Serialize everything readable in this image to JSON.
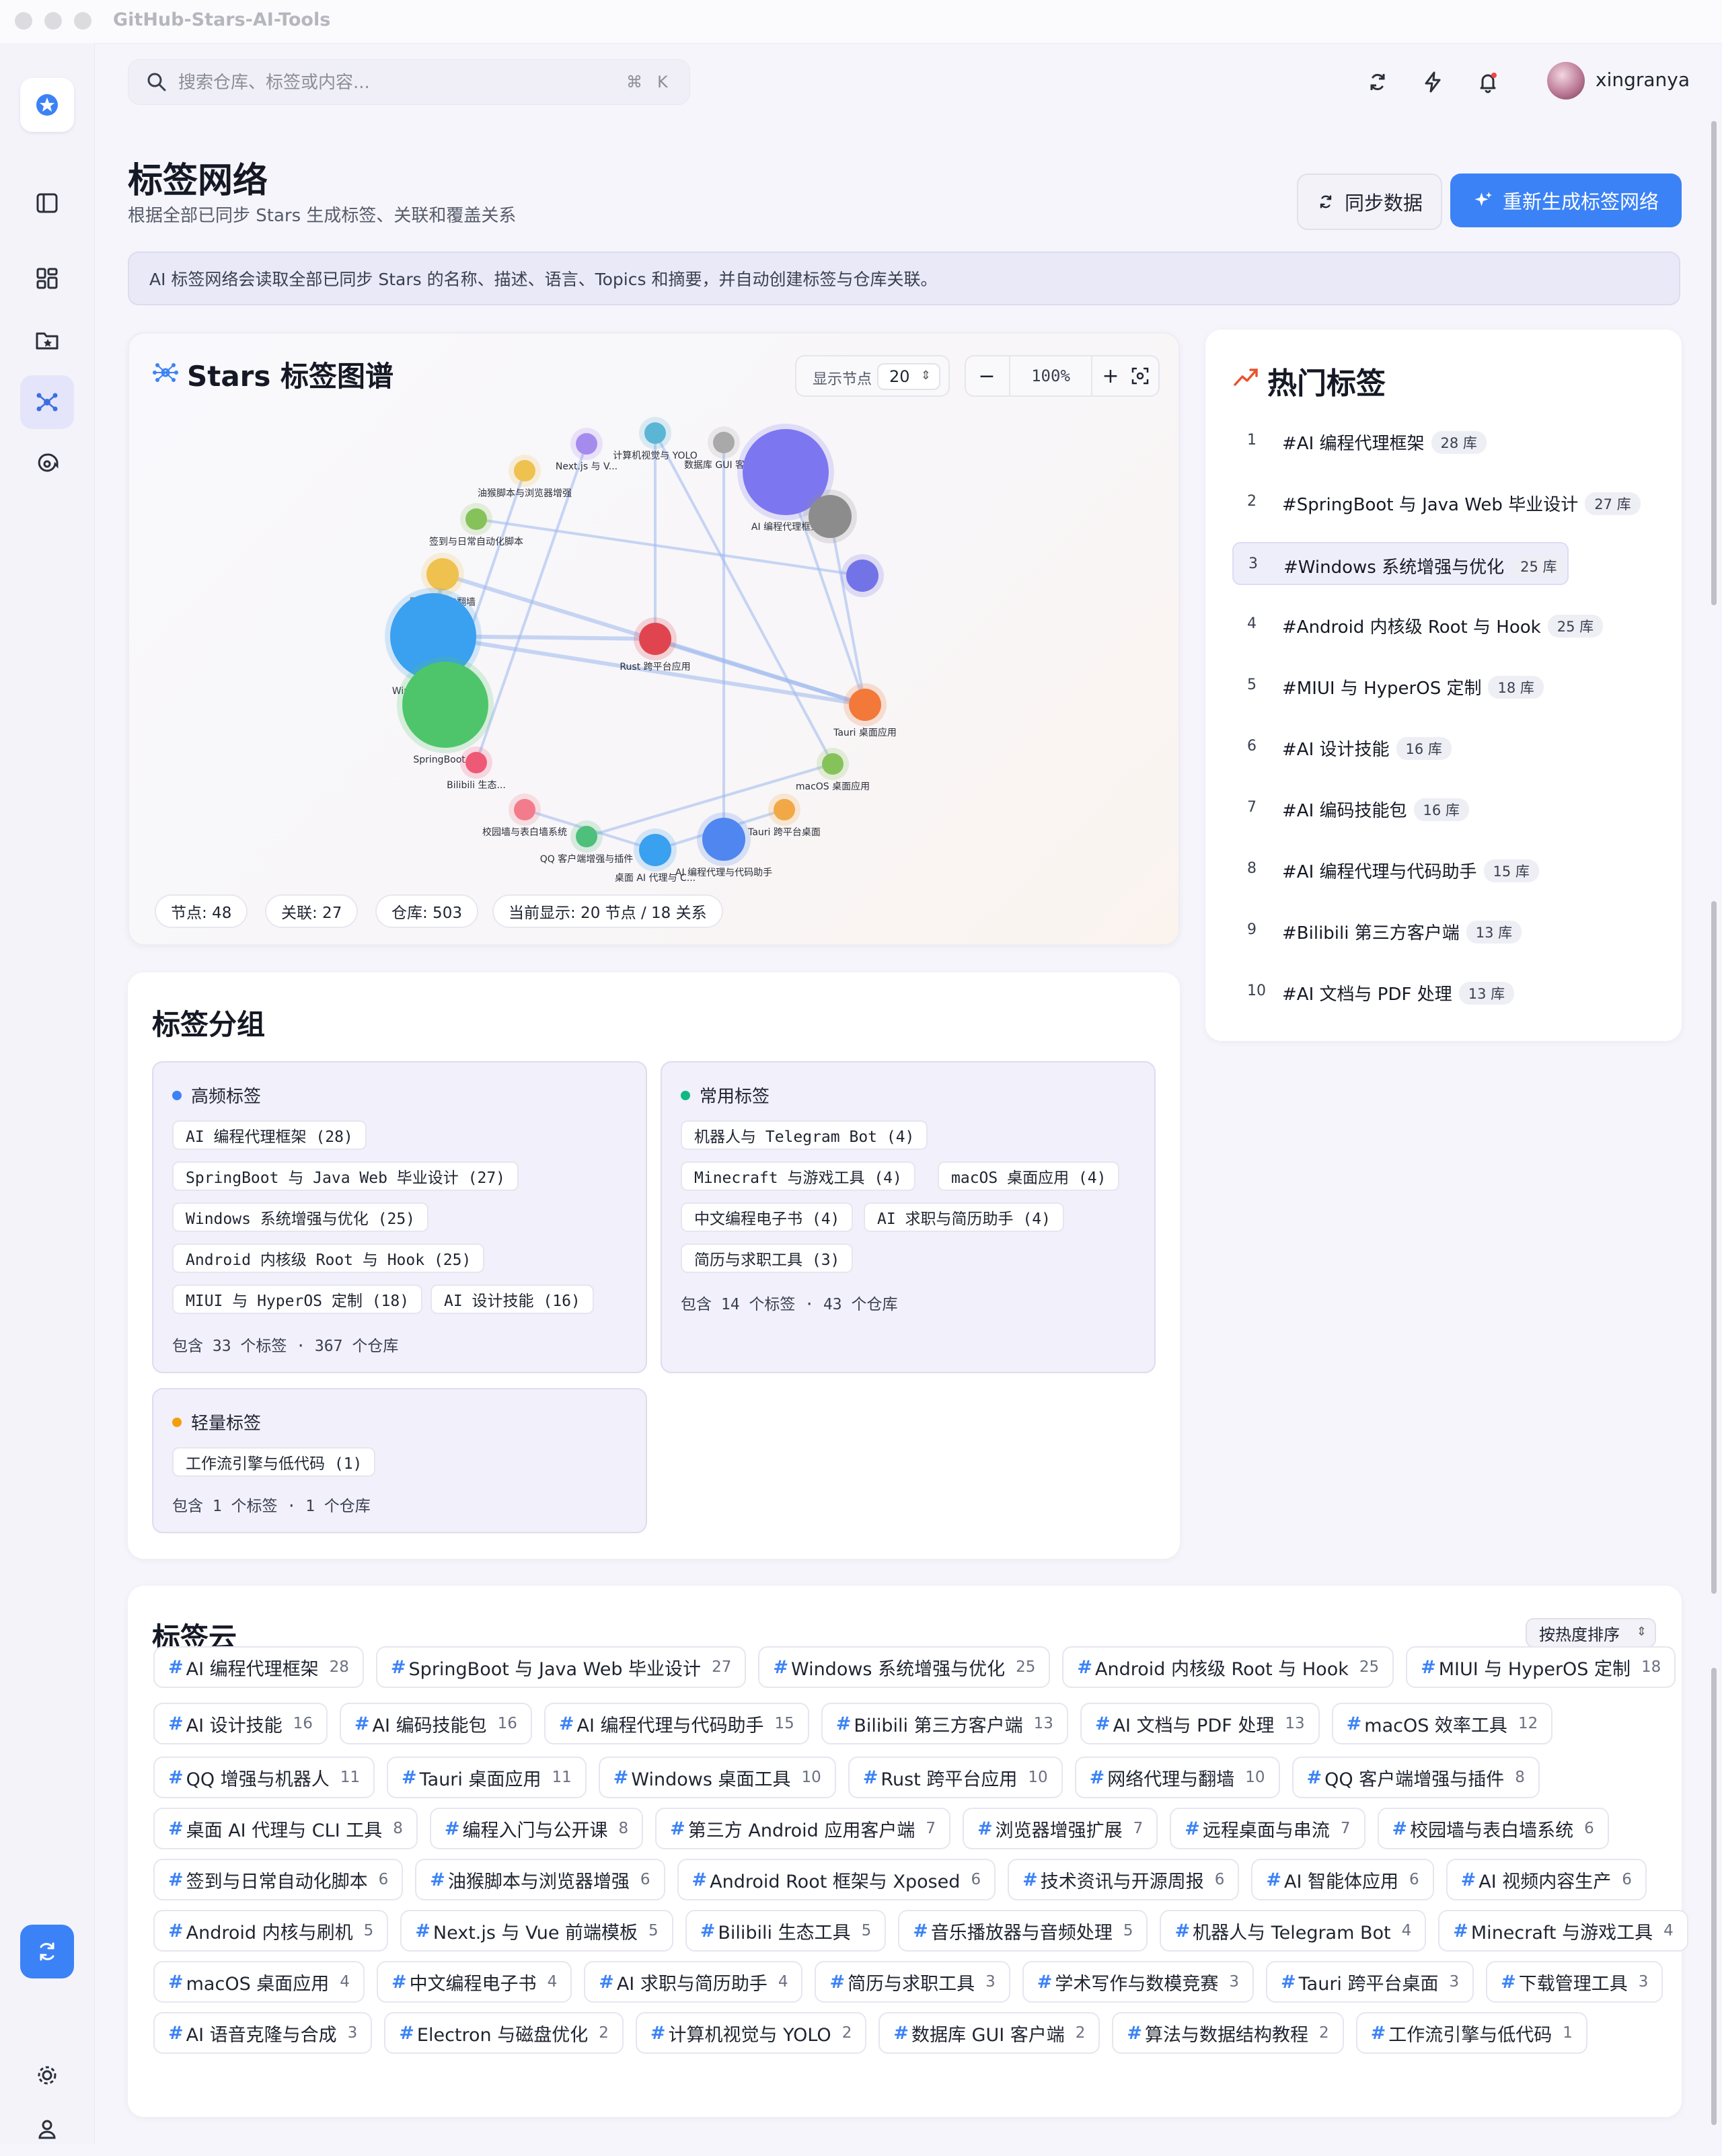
{
  "app": {
    "title": "GitHub-Stars-AI-Tools"
  },
  "topbar": {
    "search_placeholder": "搜索仓库、标签或内容...",
    "shortcut_cmd": "⌘",
    "shortcut_key": "K",
    "username": "xingranya"
  },
  "header": {
    "title": "标签网络",
    "subtitle": "根据全部已同步 Stars 生成标签、关联和覆盖关系",
    "sync_label": "同步数据",
    "regen_label": "重新生成标签网络"
  },
  "banner": {
    "text": "AI 标签网络会读取全部已同步 Stars 的名称、描述、语言、Topics 和摘要，并自动创建标签与仓库关联。"
  },
  "graph": {
    "title": "Stars 标签图谱",
    "nodes_label": "显示节点",
    "nodes_value": "20",
    "zoom": "100%",
    "nodes": [
      {
        "label": "计算机视觉与 YOLO",
        "color": "#5bb5d5",
        "size": 1
      },
      {
        "label": "数据库 GUI 客户端",
        "color": "#a9a9a9",
        "size": 1
      },
      {
        "label": "Next.js 与 V...",
        "color": "#a68bef",
        "size": 1
      },
      {
        "label": "AI 编程代理框架",
        "color": "#7c76f0",
        "size": 4
      },
      {
        "label": "油猴脚本与浏览器增强",
        "color": "#efc14f",
        "size": 1
      },
      {
        "label": "",
        "color": "#8c8c8c",
        "size": 2
      },
      {
        "label": "签到与日常自动化脚本",
        "color": "#86c25a",
        "size": 1
      },
      {
        "label": "",
        "color": "#7373e8",
        "size": 1.5
      },
      {
        "label": "网络代理与翻墙",
        "color": "#efc14f",
        "size": 1.5
      },
      {
        "label": "Windows 系统增...",
        "color": "#3aa0f0",
        "size": 4
      },
      {
        "label": "Rust 跨平台应用",
        "color": "#e0454f",
        "size": 1.5
      },
      {
        "label": "Tauri 桌面应用",
        "color": "#f2793a",
        "size": 1.5
      },
      {
        "label": "SpringBoot ...",
        "color": "#4ec56a",
        "size": 4
      },
      {
        "label": "Bilibili 生态...",
        "color": "#ee5a76",
        "size": 1
      },
      {
        "label": "macOS 桌面应用",
        "color": "#86c25a",
        "size": 1
      },
      {
        "label": "校园墙与表白墙系统",
        "color": "#f27c8c",
        "size": 1
      },
      {
        "label": "Tauri 跨平台桌面",
        "color": "#f2a846",
        "size": 1
      },
      {
        "label": "QQ 客户端增强与插件",
        "color": "#4fbf7c",
        "size": 1
      },
      {
        "label": "桌面 AI 代理与 C...",
        "color": "#3aa0f0",
        "size": 1.5
      },
      {
        "label": "AI 编程代理与代码助手",
        "color": "#4f86f0",
        "size": 2
      }
    ],
    "stats": [
      "节点: 48",
      "关联: 27",
      "仓库: 503",
      "当前显示: 20 节点 / 18 关系"
    ]
  },
  "hot_tags": {
    "title": "热门标签",
    "items": [
      {
        "rank": "1",
        "name": "#AI 编程代理框架",
        "count": "28 库"
      },
      {
        "rank": "2",
        "name": "#SpringBoot 与 Java Web 毕业设计",
        "count": "27 库"
      },
      {
        "rank": "3",
        "name": "#Windows 系统增强与优化",
        "count": "25 库"
      },
      {
        "rank": "4",
        "name": "#Android 内核级 Root 与 Hook",
        "count": "25 库"
      },
      {
        "rank": "5",
        "name": "#MIUI 与 HyperOS 定制",
        "count": "18 库"
      },
      {
        "rank": "6",
        "name": "#AI 设计技能",
        "count": "16 库"
      },
      {
        "rank": "7",
        "name": "#AI 编码技能包",
        "count": "16 库"
      },
      {
        "rank": "8",
        "name": "#AI 编程代理与代码助手",
        "count": "15 库"
      },
      {
        "rank": "9",
        "name": "#Bilibili 第三方客户端",
        "count": "13 库"
      },
      {
        "rank": "10",
        "name": "#AI 文档与 PDF 处理",
        "count": "13 库"
      }
    ]
  },
  "groups": {
    "title": "标签分组",
    "high": {
      "label": "高频标签",
      "dot": "#3b82f6",
      "tags": [
        "AI 编程代理框架 (28)",
        "SpringBoot 与 Java Web 毕业设计 (27)",
        "Windows 系统增强与优化 (25)",
        "Android 内核级 Root 与 Hook (25)",
        "MIUI 与 HyperOS 定制 (18)",
        "AI 设计技能 (16)"
      ],
      "summary": "包含 33 个标签 · 367 个仓库"
    },
    "common": {
      "label": "常用标签",
      "dot": "#10b981",
      "tags": [
        "机器人与 Telegram Bot (4)",
        "Minecraft 与游戏工具 (4)",
        "macOS 桌面应用 (4)",
        "中文编程电子书 (4)",
        "AI 求职与简历助手 (4)",
        "简历与求职工具 (3)"
      ],
      "summary": "包含 14 个标签 · 43 个仓库"
    },
    "light": {
      "label": "轻量标签",
      "dot": "#f59e0b",
      "tags": [
        "工作流引擎与低代码 (1)"
      ],
      "summary": "包含 1 个标签 · 1 个仓库"
    }
  },
  "cloud": {
    "title": "标签云",
    "sort_label": "按热度排序",
    "rows": [
      [
        {
          "name": "AI 编程代理框架",
          "count": "28"
        },
        {
          "name": "SpringBoot 与 Java Web 毕业设计",
          "count": "27"
        },
        {
          "name": "Windows 系统增强与优化",
          "count": "25"
        },
        {
          "name": "Android 内核级 Root 与 Hook",
          "count": "25"
        },
        {
          "name": "MIUI 与 HyperOS 定制",
          "count": "18"
        }
      ],
      [
        {
          "name": "AI 设计技能",
          "count": "16"
        },
        {
          "name": "AI 编码技能包",
          "count": "16"
        },
        {
          "name": "AI 编程代理与代码助手",
          "count": "15"
        },
        {
          "name": "Bilibili 第三方客户端",
          "count": "13"
        },
        {
          "name": "AI 文档与 PDF 处理",
          "count": "13"
        },
        {
          "name": "macOS 效率工具",
          "count": "12"
        }
      ],
      [
        {
          "name": "QQ 增强与机器人",
          "count": "11"
        },
        {
          "name": "Tauri 桌面应用",
          "count": "11"
        },
        {
          "name": "Windows 桌面工具",
          "count": "10"
        },
        {
          "name": "Rust 跨平台应用",
          "count": "10"
        },
        {
          "name": "网络代理与翻墙",
          "count": "10"
        },
        {
          "name": "QQ 客户端增强与插件",
          "count": "8"
        }
      ],
      [
        {
          "name": "桌面 AI 代理与 CLI 工具",
          "count": "8"
        },
        {
          "name": "编程入门与公开课",
          "count": "8"
        },
        {
          "name": "第三方 Android 应用客户端",
          "count": "7"
        },
        {
          "name": "浏览器增强扩展",
          "count": "7"
        },
        {
          "name": "远程桌面与串流",
          "count": "7"
        },
        {
          "name": "校园墙与表白墙系统",
          "count": "6"
        }
      ],
      [
        {
          "name": "签到与日常自动化脚本",
          "count": "6"
        },
        {
          "name": "油猴脚本与浏览器增强",
          "count": "6"
        },
        {
          "name": "Android Root 框架与 Xposed",
          "count": "6"
        },
        {
          "name": "技术资讯与开源周报",
          "count": "6"
        },
        {
          "name": "AI 智能体应用",
          "count": "6"
        },
        {
          "name": "AI 视频内容生产",
          "count": "6"
        }
      ],
      [
        {
          "name": "Android 内核与刷机",
          "count": "5"
        },
        {
          "name": "Next.js 与 Vue 前端模板",
          "count": "5"
        },
        {
          "name": "Bilibili 生态工具",
          "count": "5"
        },
        {
          "name": "音乐播放器与音频处理",
          "count": "5"
        },
        {
          "name": "机器人与 Telegram Bot",
          "count": "4"
        },
        {
          "name": "Minecraft 与游戏工具",
          "count": "4"
        }
      ],
      [
        {
          "name": "macOS 桌面应用",
          "count": "4"
        },
        {
          "name": "中文编程电子书",
          "count": "4"
        },
        {
          "name": "AI 求职与简历助手",
          "count": "4"
        },
        {
          "name": "简历与求职工具",
          "count": "3"
        },
        {
          "name": "学术写作与数模竞赛",
          "count": "3"
        },
        {
          "name": "Tauri 跨平台桌面",
          "count": "3"
        },
        {
          "name": "下载管理工具",
          "count": "3"
        }
      ],
      [
        {
          "name": "AI 语音克隆与合成",
          "count": "3"
        },
        {
          "name": "Electron 与磁盘优化",
          "count": "2"
        },
        {
          "name": "计算机视觉与 YOLO",
          "count": "2"
        },
        {
          "name": "数据库 GUI 客户端",
          "count": "2"
        },
        {
          "name": "算法与数据结构教程",
          "count": "2"
        },
        {
          "name": "工作流引擎与低代码",
          "count": "1"
        }
      ]
    ]
  }
}
